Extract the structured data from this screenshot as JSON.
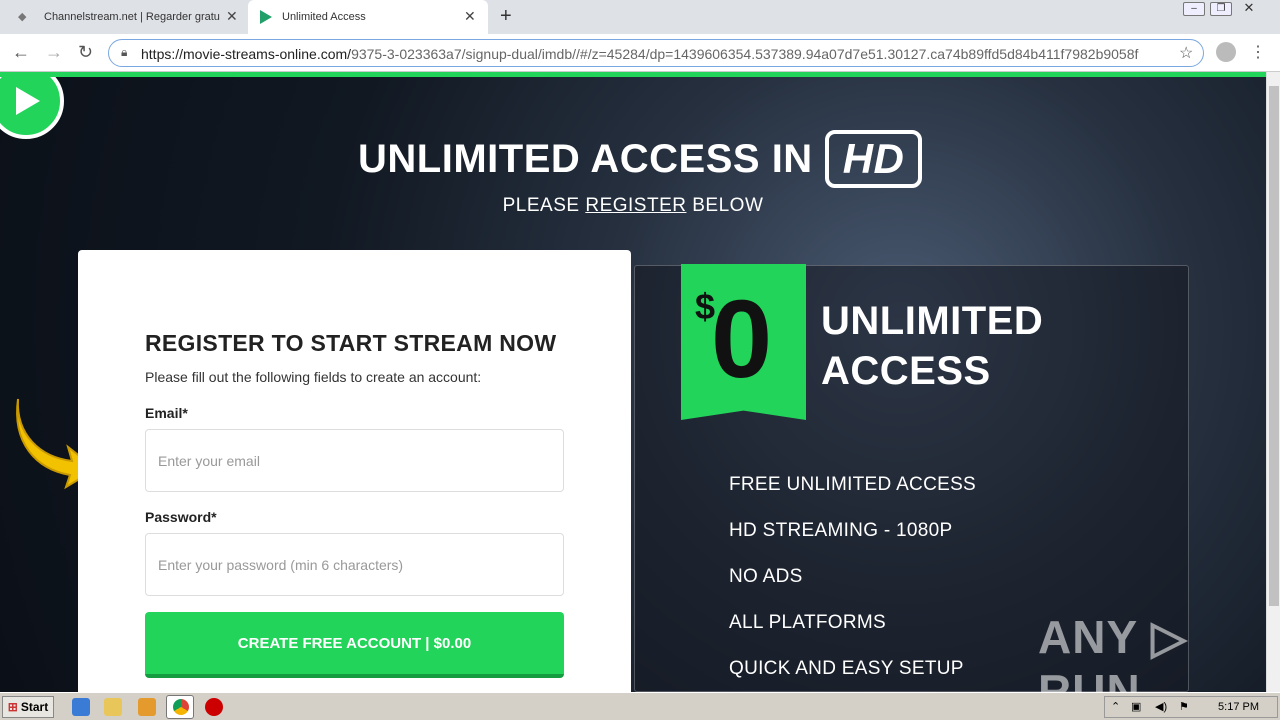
{
  "browser": {
    "tabs": [
      {
        "title": "Channelstream.net | Regarder gratu",
        "close": "✕"
      },
      {
        "title": "Unlimited Access",
        "close": "✕"
      }
    ],
    "new_tab": "+",
    "url_host": "https://movie-streams-online.com/",
    "url_rest": "9375-3-023363a7/signup-dual/imdb//#/z=45284/dp=1439606354.537389.94a07d7e51.30127.ca74b89ffd5d84b411f7982b9058f"
  },
  "hero": {
    "headline": "UNLIMITED ACCESS IN",
    "badge": "HD",
    "sub_pre": "PLEASE ",
    "sub_link": "REGISTER",
    "sub_post": " BELOW"
  },
  "form": {
    "title": "REGISTER TO START STREAM NOW",
    "description": "Please fill out the following fields to create an account:",
    "email_label": "Email*",
    "email_placeholder": "Enter your email",
    "password_label": "Password*",
    "password_placeholder": "Enter your password (min 6 characters)",
    "submit_label": "CREATE FREE ACCOUNT | $0.00"
  },
  "promo": {
    "currency": "$",
    "price": "0",
    "title_line1": "UNLIMITED",
    "title_line2": "ACCESS",
    "features": [
      "FREE UNLIMITED ACCESS",
      "HD STREAMING - 1080P",
      "NO ADS",
      "ALL PLATFORMS",
      "QUICK AND EASY SETUP"
    ]
  },
  "watermark": "ANY ▷ RUN",
  "taskbar": {
    "start_label": "Start",
    "clock": "5:17 PM"
  },
  "colors": {
    "accent": "#22d45a",
    "accent_dark": "#159c40"
  }
}
